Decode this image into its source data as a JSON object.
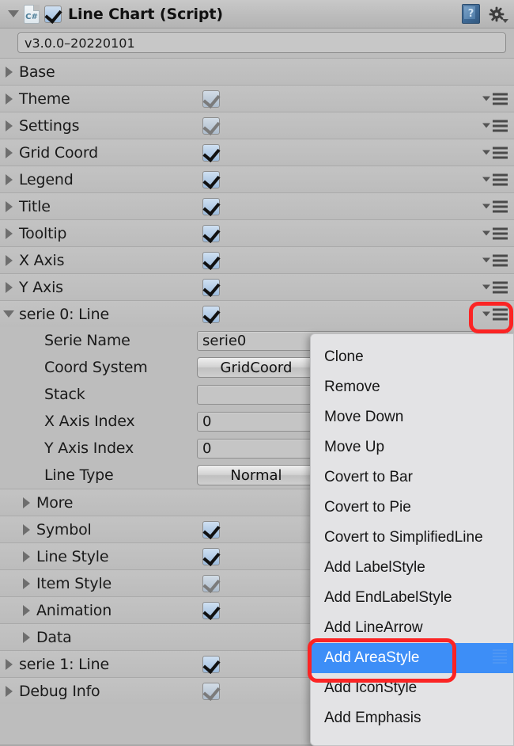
{
  "header": {
    "foldout_icon": "triangle-down-icon",
    "script_icon": "csharp-script-icon",
    "script_icon_label": "C#",
    "enabled": true,
    "title": "Line Chart (Script)",
    "help_icon": "help-book-icon",
    "help_glyph": "?",
    "settings_icon": "gear-icon"
  },
  "version": {
    "label": "version-field",
    "value": "v3.0.0–20220101"
  },
  "rows": [
    {
      "label": "Base",
      "expanded": false,
      "indent": 0,
      "checkbox": null,
      "menu": false
    },
    {
      "label": "Theme",
      "expanded": false,
      "indent": 0,
      "checkbox": "checked-dim",
      "menu": true
    },
    {
      "label": "Settings",
      "expanded": false,
      "indent": 0,
      "checkbox": "checked-dim",
      "menu": true
    },
    {
      "label": "Grid Coord",
      "expanded": false,
      "indent": 0,
      "checkbox": "checked",
      "menu": true
    },
    {
      "label": "Legend",
      "expanded": false,
      "indent": 0,
      "checkbox": "checked",
      "menu": true
    },
    {
      "label": "Title",
      "expanded": false,
      "indent": 0,
      "checkbox": "checked",
      "menu": true
    },
    {
      "label": "Tooltip",
      "expanded": false,
      "indent": 0,
      "checkbox": "checked",
      "menu": true
    },
    {
      "label": "X Axis",
      "expanded": false,
      "indent": 0,
      "checkbox": "checked",
      "menu": true
    },
    {
      "label": "Y Axis",
      "expanded": false,
      "indent": 0,
      "checkbox": "checked",
      "menu": true
    },
    {
      "label": "serie 0: Line",
      "expanded": true,
      "indent": 0,
      "checkbox": "checked",
      "menu": true
    }
  ],
  "serie0_properties": [
    {
      "label": "Serie Name",
      "control": "text",
      "value": "serie0"
    },
    {
      "label": "Coord System",
      "control": "popup",
      "value": "GridCoord"
    },
    {
      "label": "Stack",
      "control": "text",
      "value": ""
    },
    {
      "label": "X Axis Index",
      "control": "text",
      "value": "0"
    },
    {
      "label": "Y Axis Index",
      "control": "text",
      "value": "0"
    },
    {
      "label": "Line Type",
      "control": "popup",
      "value": "Normal"
    }
  ],
  "serie0_subrows": [
    {
      "label": "More",
      "indent": 1,
      "checkbox": null,
      "menu": false
    },
    {
      "label": "Symbol",
      "indent": 1,
      "checkbox": "checked",
      "menu": false
    },
    {
      "label": "Line Style",
      "indent": 1,
      "checkbox": "checked",
      "menu": false
    },
    {
      "label": "Item Style",
      "indent": 1,
      "checkbox": "checked-dim",
      "menu": false
    },
    {
      "label": "Animation",
      "indent": 1,
      "checkbox": "checked",
      "menu": false
    },
    {
      "label": "Data",
      "indent": 1,
      "checkbox": null,
      "menu": false
    }
  ],
  "tail_rows": [
    {
      "label": "serie 1: Line",
      "expanded": false,
      "indent": 0,
      "checkbox": "checked",
      "menu": true
    },
    {
      "label": "Debug Info",
      "expanded": false,
      "indent": 0,
      "checkbox": "checked-dim",
      "menu": true
    }
  ],
  "context_menu": {
    "items": [
      {
        "label": "Clone",
        "selected": false
      },
      {
        "label": "Remove",
        "selected": false
      },
      {
        "label": "Move Down",
        "selected": false
      },
      {
        "label": "Move Up",
        "selected": false
      },
      {
        "label": "Covert to Bar",
        "selected": false
      },
      {
        "label": "Covert to Pie",
        "selected": false
      },
      {
        "label": "Covert to SimplifiedLine",
        "selected": false
      },
      {
        "label": "Add LabelStyle",
        "selected": false
      },
      {
        "label": "Add EndLabelStyle",
        "selected": false
      },
      {
        "label": "Add LineArrow",
        "selected": false
      },
      {
        "label": "Add AreaStyle",
        "selected": true
      },
      {
        "label": "Add IconStyle",
        "selected": false
      },
      {
        "label": "Add Emphasis",
        "selected": false
      }
    ]
  },
  "annotations": [
    {
      "name": "serie0-menu-icon-highlight",
      "color": "#fb2424"
    },
    {
      "name": "add-areastyle-highlight",
      "color": "#fb2424"
    }
  ],
  "colors": {
    "panel_bg": "#bdbdbd",
    "row_sep": "#a9a9a9",
    "menu_bg": "#e3e3e5",
    "menu_selected": "#3d8ef7",
    "annotation_red": "#fb2424",
    "checkbox_blue": "#9dbcdd"
  }
}
